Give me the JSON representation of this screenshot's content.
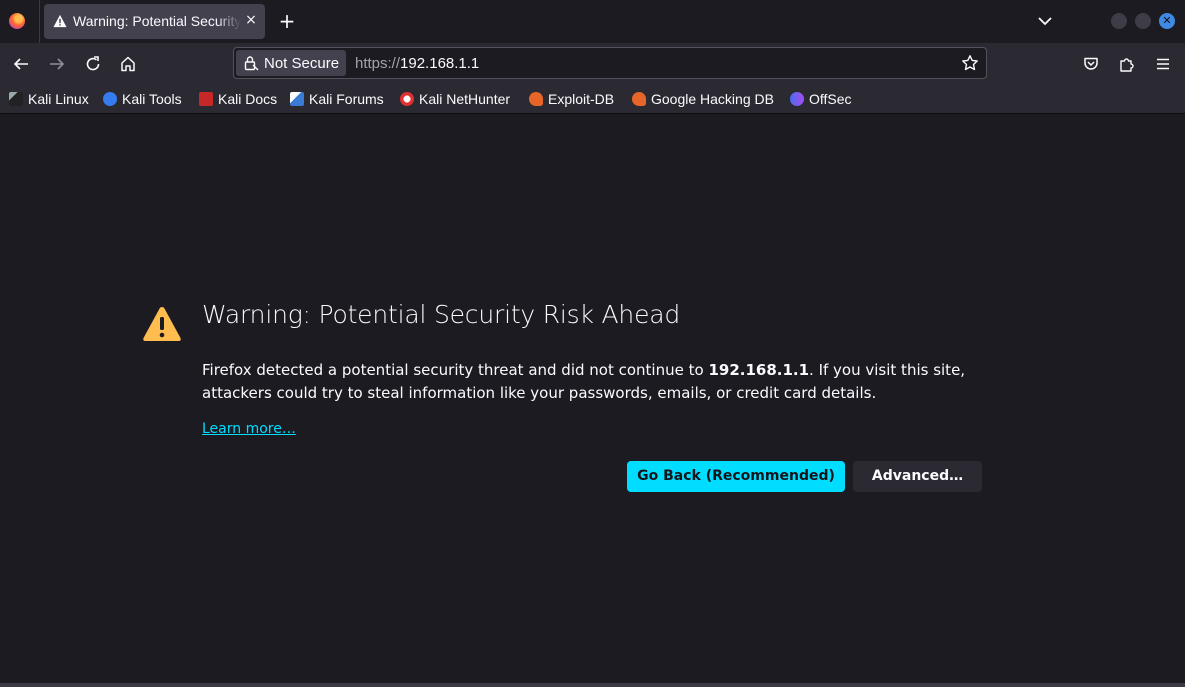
{
  "tab": {
    "title": "Warning: Potential Security Risk Ahead",
    "close": "×",
    "new_tab": "+"
  },
  "window": {
    "close": "✕"
  },
  "urlbar": {
    "identity_label": "Not Secure",
    "scheme": "https://",
    "host": "192.168.1.1"
  },
  "bookmarks": [
    {
      "label": "Kali Linux",
      "color": "#2f2f2f"
    },
    {
      "label": "Kali Tools",
      "color": "#367bf0"
    },
    {
      "label": "Kali Docs",
      "color": "#d33"
    },
    {
      "label": "Kali Forums",
      "color": "#3a7bd5"
    },
    {
      "label": "Kali NetHunter",
      "color": "#e03030"
    },
    {
      "label": "Exploit-DB",
      "color": "#e8652a"
    },
    {
      "label": "Google Hacking DB",
      "color": "#e8652a"
    },
    {
      "label": "OffSec",
      "color": "#4a6cf0"
    }
  ],
  "error_page": {
    "title": "Warning: Potential Security Risk Ahead",
    "desc_pre": "Firefox detected a potential security threat and did not continue to ",
    "desc_host": "192.168.1.1",
    "desc_post": ". If you visit this site, attackers could try to steal information like your passwords, emails, or credit card details.",
    "learn_more": "Learn more…",
    "go_back_label": "Go Back (Recommended)",
    "advanced_label": "Advanced…"
  },
  "colors": {
    "accent": "#00ddff",
    "warning": "#ffbd4f",
    "background": "#1c1b22",
    "toolbar": "#2b2a33"
  }
}
